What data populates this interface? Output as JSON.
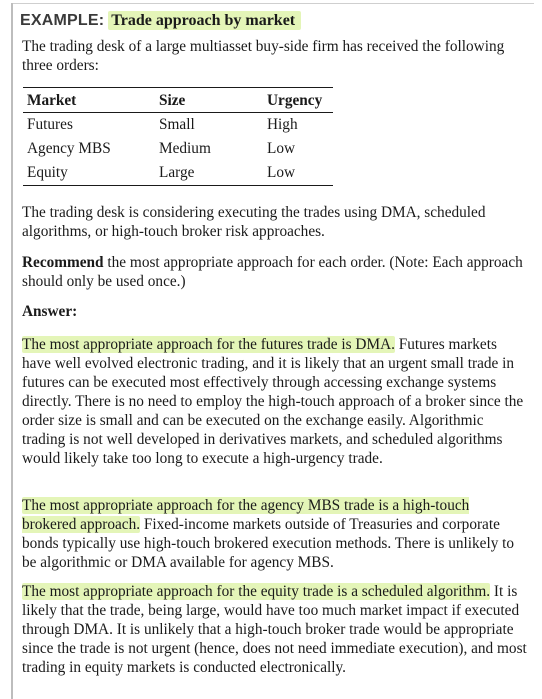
{
  "example": {
    "label": "EXAMPLE:",
    "title": "Trade approach by market"
  },
  "intro": "The trading desk of a large multiasset buy-side firm has received the following three orders:",
  "table": {
    "headers": [
      "Market",
      "Size",
      "Urgency"
    ],
    "rows": [
      [
        "Futures",
        "Small",
        "High"
      ],
      [
        "Agency MBS",
        "Medium",
        "Low"
      ],
      [
        "Equity",
        "Large",
        "Low"
      ]
    ]
  },
  "considering": "The trading desk is considering executing the trades using DMA, scheduled algorithms, or high-touch broker risk approaches.",
  "task": {
    "keyword": "Recommend",
    "text": " the most appropriate approach for each order. (Note: Each approach should only be used once.)"
  },
  "answer_label": "Answer:",
  "answers": [
    {
      "highlight": "The most appropriate approach for the futures trade is DMA.",
      "text": " Futures markets have well evolved electronic trading, and it is likely that an urgent small trade in futures can be executed most effectively through accessing exchange systems directly. There is no need to employ the high-touch approach of a broker since the order size is small and can be executed on the exchange easily. Algorithmic trading is not well developed in derivatives markets, and scheduled algorithms would likely take too long to execute a high-urgency trade."
    },
    {
      "highlight": "The most appropriate approach for the agency MBS trade is a high-touch brokered approach.",
      "text": " Fixed-income markets outside of Treasuries and corporate bonds typically use high-touch brokered execution methods. There is unlikely to be algorithmic or DMA available for agency MBS."
    },
    {
      "highlight": "The most appropriate approach for the equity trade is a scheduled algorithm.",
      "text": " It is likely that the trade, being large, would have too much market impact if executed through DMA. It is unlikely that a high-touch broker trade would be appropriate since the trade is not urgent (hence, does not need immediate execution), and most trading in equity markets is conducted electronically."
    }
  ],
  "colors": {
    "highlight": "#e4f5b8",
    "text": "#1a1a1a"
  }
}
